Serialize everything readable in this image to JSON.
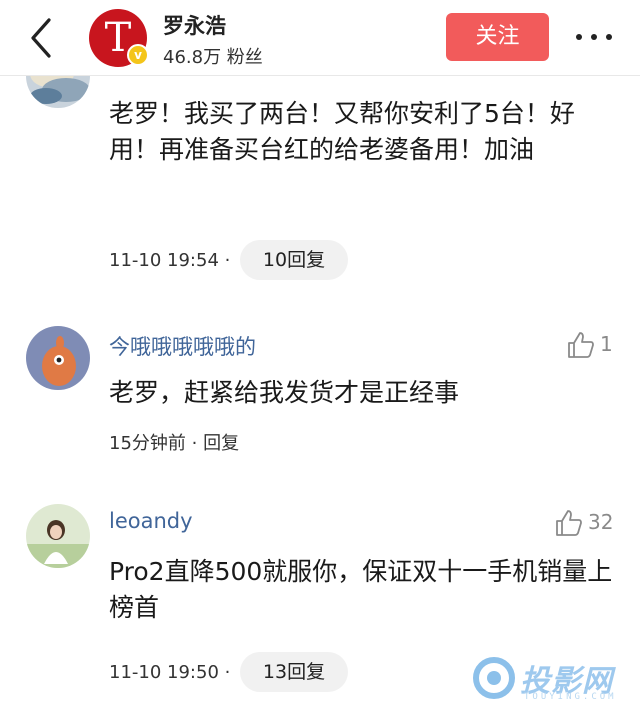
{
  "header": {
    "author_name": "罗永浩",
    "fans_text": "46.8万 粉丝",
    "follow_label": "关注",
    "avatar_letter": "T",
    "badge_symbol": "v",
    "brand_color": "#c8151e",
    "follow_color": "#f25b5b"
  },
  "comments": [
    {
      "text": "老罗！我买了两台！又帮你安利了5台！好用！再准备买台红的给老婆备用！加油",
      "time": "11-10 19:54 ·",
      "reply_label": "10回复"
    },
    {
      "username": "今哦哦哦哦哦的",
      "likes": "1",
      "text": "老罗，赶紧给我发货才是正经事",
      "time": "15分钟前 · 回复"
    },
    {
      "username": "leoandy",
      "likes": "32",
      "text": "Pro2直降500就服你，保证双十一手机销量上榜首",
      "time": "11-10 19:50 ·",
      "reply_label": "13回复"
    }
  ],
  "watermark": {
    "text": "投影网",
    "sub": "TOUYING.COM"
  },
  "colors": {
    "username": "#406599",
    "pill_bg": "#f1f1f1"
  }
}
